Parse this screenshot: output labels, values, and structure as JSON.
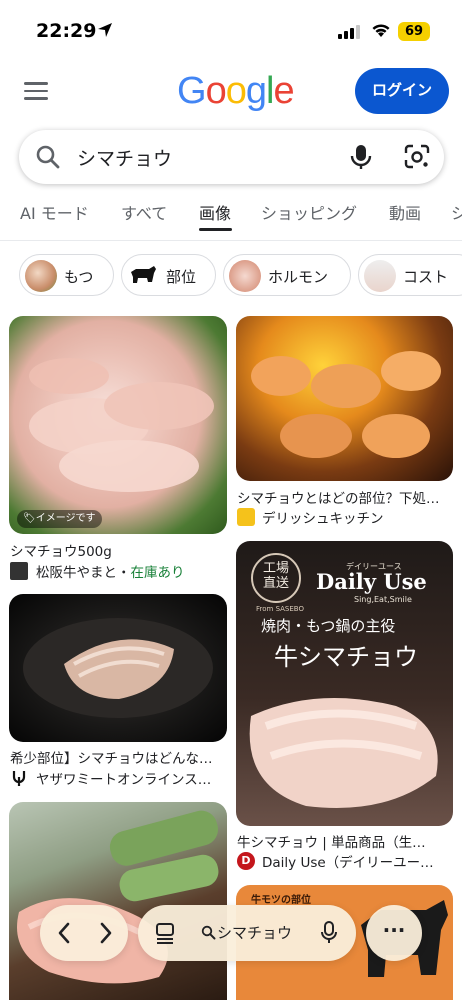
{
  "status_bar": {
    "time": "22:29",
    "battery": "69"
  },
  "header": {
    "logo_text": "Google",
    "login_label": "ログイン"
  },
  "search": {
    "query": "シマチョウ"
  },
  "tabs": [
    {
      "label": "AI モード"
    },
    {
      "label": "すべて"
    },
    {
      "label": "画像",
      "active": true
    },
    {
      "label": "ショッピング"
    },
    {
      "label": "動画"
    },
    {
      "label": "シ"
    }
  ],
  "chips": [
    {
      "label": "もつ"
    },
    {
      "label": "部位"
    },
    {
      "label": "ホルモン"
    },
    {
      "label": "コスト"
    }
  ],
  "results": {
    "left": [
      {
        "badge": "イメージです",
        "title": "シマチョウ500g",
        "source": "松阪牛やまと",
        "source_sep": "・",
        "stock": "在庫あり"
      },
      {
        "title": "希少部位】シマチョウはどんな…",
        "source": "ヤザワミートオンラインス…"
      },
      {
        "title": "",
        "source": ""
      }
    ],
    "right": [
      {
        "title": "シマチョウとはどの部位？下処…",
        "source": "デリッシュキッチン"
      },
      {
        "title": "牛シマチョウ | 単品商品（生…",
        "source": "Daily Use（デイリーユー…",
        "ad_stamp_line1": "工場",
        "ad_stamp_line2": "直送",
        "ad_stamp_sub": "From SASEBO",
        "ad_brand_small": "デイリーユース",
        "ad_brand": "Daily Use",
        "ad_tagline": "Sing,Eat,Smile",
        "ad_caption": "焼肉・もつ鍋の主役",
        "ad_product": "牛シマチョウ"
      },
      {
        "ad_caption": "牛モツの部位"
      }
    ]
  },
  "bottom_bar": {
    "search_text": "シマチョウ",
    "more_label": "···"
  },
  "colors": {
    "accent": "#0b57d0",
    "stock_green": "#188038"
  }
}
